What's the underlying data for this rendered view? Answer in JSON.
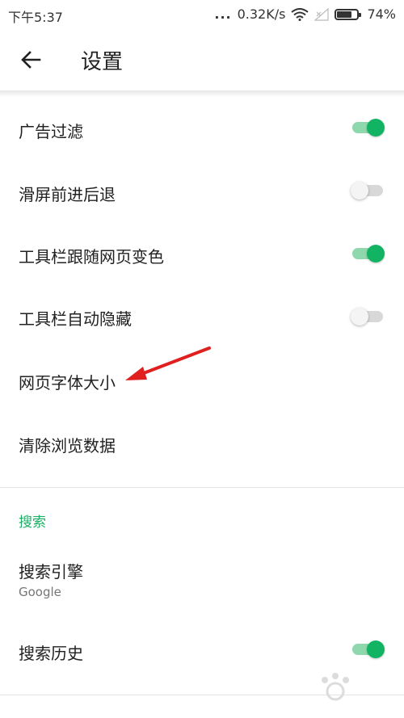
{
  "status_bar": {
    "time": "下午5:37",
    "dots": "...",
    "network_speed": "0.32K/s",
    "battery_percent": "74%",
    "battery_level": 0.74
  },
  "app_bar": {
    "title": "设置"
  },
  "settings": {
    "ad_filter": {
      "label": "广告过滤",
      "enabled": true
    },
    "swipe_nav": {
      "label": "滑屏前进后退",
      "enabled": false
    },
    "toolbar_color": {
      "label": "工具栏跟随网页变色",
      "enabled": true
    },
    "toolbar_autohide": {
      "label": "工具栏自动隐藏",
      "enabled": false
    },
    "font_size": {
      "label": "网页字体大小"
    },
    "clear_data": {
      "label": "清除浏览数据"
    }
  },
  "search_section": {
    "header": "搜索",
    "engine": {
      "label": "搜索引擎",
      "value": "Google"
    },
    "history": {
      "label": "搜索历史",
      "enabled": true
    }
  },
  "colors": {
    "accent": "#12b464",
    "annotation_arrow": "#e0201e"
  }
}
